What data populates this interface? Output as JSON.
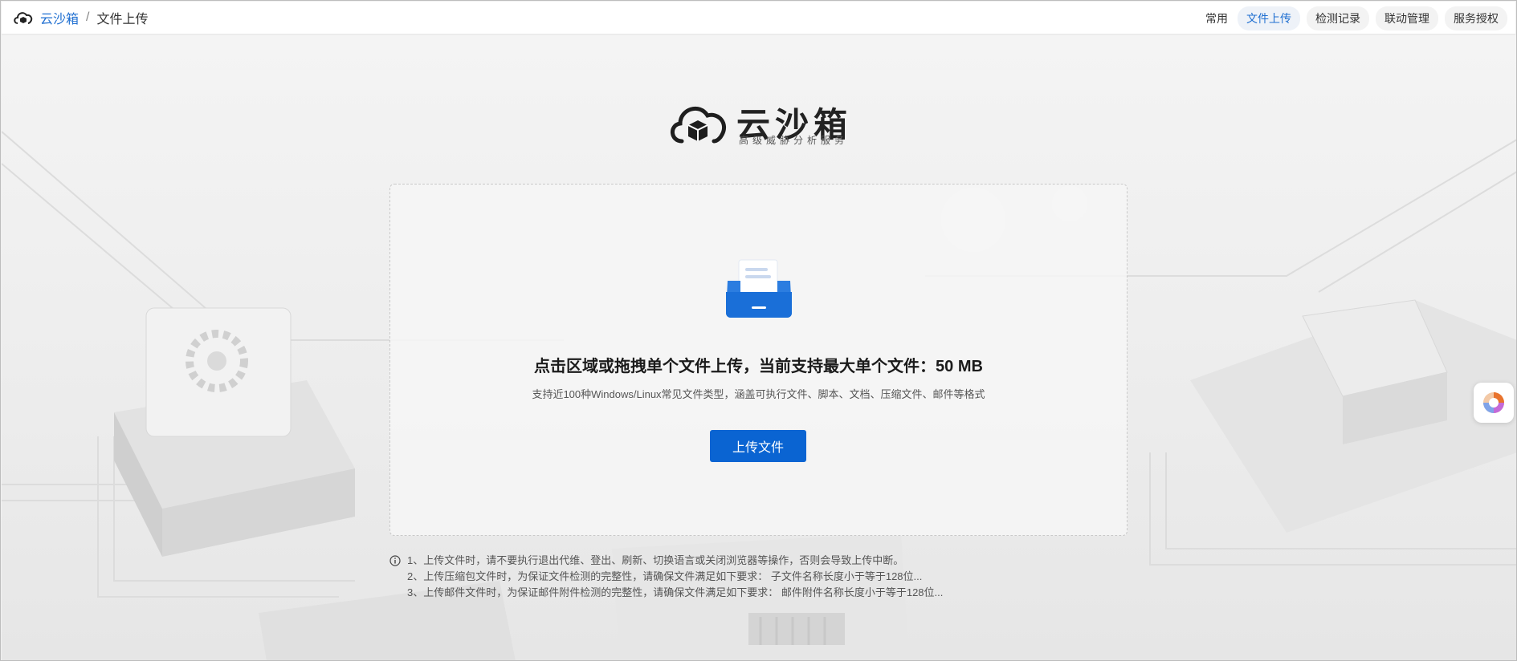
{
  "breadcrumb": {
    "root": "云沙箱",
    "separator": "/",
    "current": "文件上传"
  },
  "nav": {
    "items": [
      {
        "label": "常用"
      },
      {
        "label": "文件上传"
      },
      {
        "label": "检测记录"
      },
      {
        "label": "联动管理"
      },
      {
        "label": "服务授权"
      }
    ],
    "active_index": 1
  },
  "brand": {
    "name": "云沙箱",
    "tagline": "高级威胁分析服务",
    "icon": "cloud-cube-logo-icon"
  },
  "upload": {
    "title": "点击区域或拖拽单个文件上传，当前支持最大单个文件：50 MB",
    "subtitle": "支持近100种Windows/Linux常见文件类型，涵盖可执行文件、脚本、文档、压缩文件、邮件等格式",
    "button_label": "上传文件",
    "icon": "file-drawer-icon"
  },
  "notes": {
    "icon": "info-circle-icon",
    "lines": [
      "1、上传文件时，请不要执行退出代维、登出、刷新、切换语言或关闭浏览器等操作，否则会导致上传中断。",
      "2、上传压缩包文件时，为保证文件检测的完整性，请确保文件满足如下要求： 子文件名称长度小于等于128位...",
      "3、上传邮件文件时，为保证邮件附件检测的完整性，请确保文件满足如下要求： 邮件附件名称长度小于等于128位..."
    ]
  },
  "colors": {
    "accent": "#0a64d2",
    "link": "#1f6fd1",
    "nav_active_bg": "#eef2f8"
  }
}
